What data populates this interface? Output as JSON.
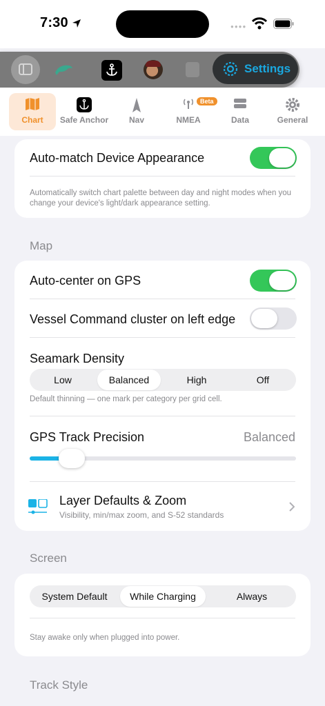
{
  "status_bar": {
    "time": "7:30"
  },
  "switcher": {
    "settings_label": "Settings"
  },
  "tabs": [
    {
      "label": "Chart",
      "icon": "map-icon"
    },
    {
      "label": "Safe Anchor",
      "icon": "anchor-icon"
    },
    {
      "label": "Nav",
      "icon": "compass-needle-icon"
    },
    {
      "label": "NMEA",
      "icon": "antenna-icon",
      "badge": "Beta"
    },
    {
      "label": "Data",
      "icon": "database-icon"
    },
    {
      "label": "General",
      "icon": "gear-icon"
    }
  ],
  "appearance": {
    "auto_match_label": "Auto-match Device Appearance",
    "auto_match_on": true,
    "help": "Automatically switch chart palette between day and night modes when you change your device's light/dark appearance setting."
  },
  "map": {
    "section_title": "Map",
    "auto_center_label": "Auto-center on GPS",
    "auto_center_on": true,
    "vessel_cluster_label": "Vessel Command cluster on left edge",
    "vessel_cluster_on": false,
    "seamark_label": "Seamark Density",
    "seamark_options": [
      "Low",
      "Balanced",
      "High",
      "Off"
    ],
    "seamark_selected": "Balanced",
    "seamark_help": "Default thinning — one mark per category per grid cell.",
    "gps_precision_label": "GPS Track Precision",
    "gps_precision_value": "Balanced",
    "gps_precision_level": 0.12,
    "layer_title": "Layer Defaults & Zoom",
    "layer_subtitle": "Visibility, min/max zoom, and S-52 standards"
  },
  "screen": {
    "section_title": "Screen",
    "options": [
      "System Default",
      "While Charging",
      "Always"
    ],
    "selected": "While Charging",
    "help": "Stay awake only when plugged into power."
  },
  "track_style": {
    "section_title": "Track Style"
  },
  "colors": {
    "accent": "#f0912c",
    "toggle_on": "#34c759",
    "slider": "#1bb3e6",
    "settings_blue": "#1aa8e0"
  }
}
